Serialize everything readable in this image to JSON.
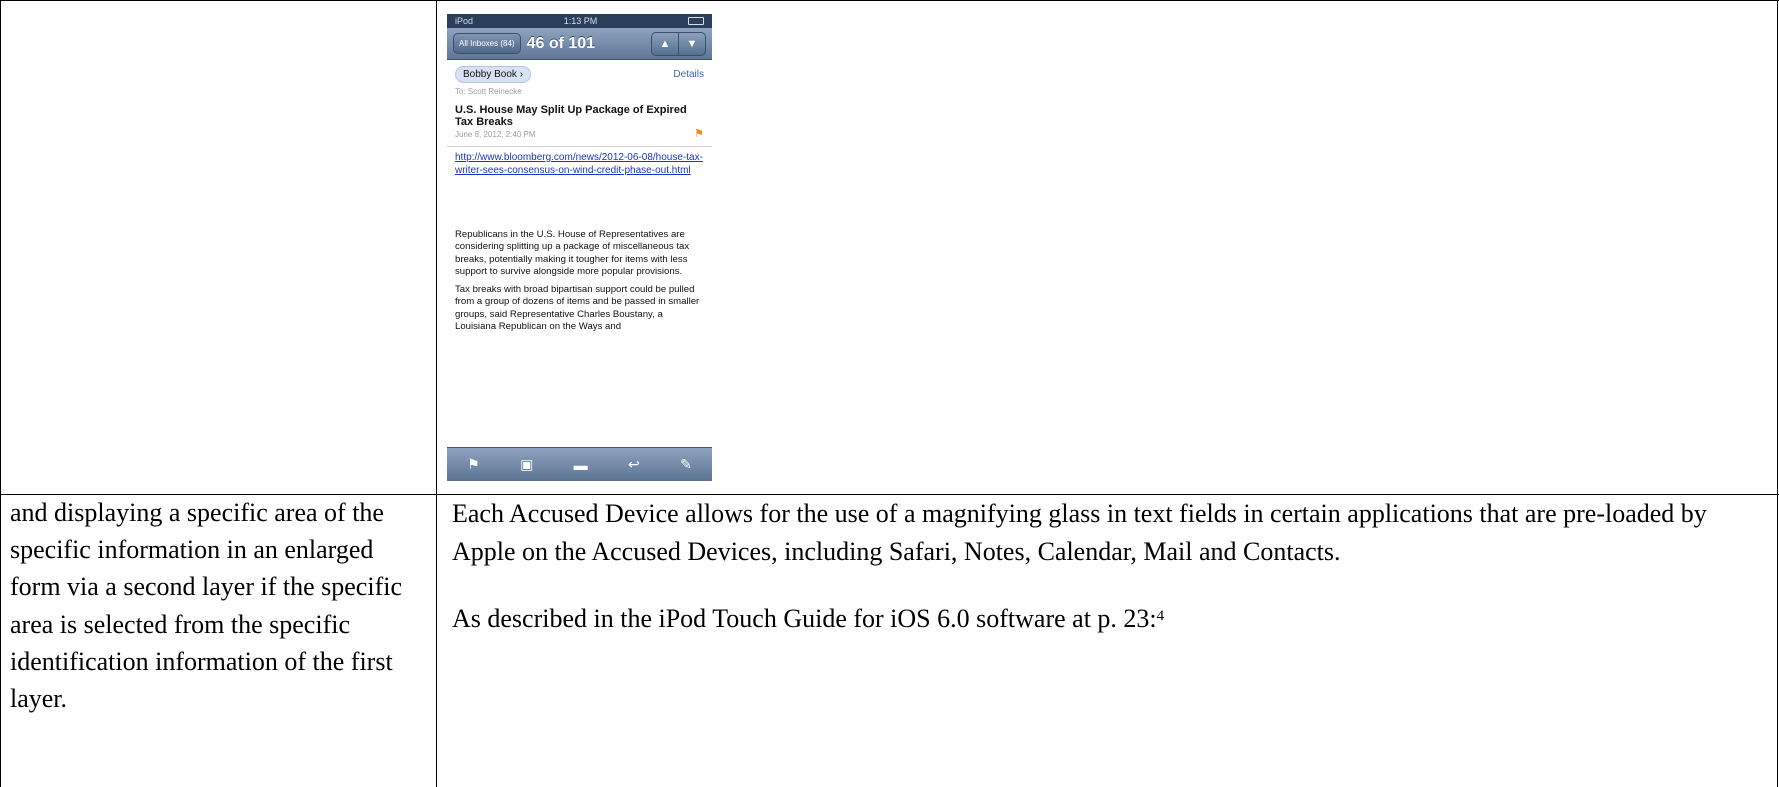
{
  "phone": {
    "status": {
      "carrier": "iPod",
      "time": "1:13 PM"
    },
    "nav": {
      "back_label": "All Inboxes (84)",
      "count": "46 of 101",
      "up_icon": "triangle-up-icon",
      "down_icon": "triangle-down-icon"
    },
    "mail": {
      "sender": "Bobby Book",
      "details": "Details",
      "to": "To: Scott Reinecke",
      "subject": "U.S. House May Split Up Package of Expired Tax Breaks",
      "date": "June 8, 2012, 2:40 PM",
      "link": "http://www.bloomberg.com/news/2012-06-08/house-tax-writer-sees-consensus-on-wind-credit-phase-out.html",
      "paragraph1": "Republicans in the U.S. House of Representatives are considering splitting up a package of miscellaneous tax breaks, potentially making it tougher for items with less support to survive alongside more popular provisions.",
      "paragraph2": "Tax breaks with broad bipartisan support could be pulled from a group of dozens of items and be passed in smaller groups, said Representative Charles Boustany, a Louisiana Republican on the Ways and"
    },
    "toolbar": [
      "flag-icon",
      "move-folder-icon",
      "archive-icon",
      "reply-icon",
      "compose-icon"
    ]
  },
  "claim": {
    "text": "and displaying a specific area of the specific information in an enlarged form via a second layer if the specific area is selected from the specific identification information of the first layer."
  },
  "description": {
    "paragraph1": "Each Accused Device allows for the use of a magnifying glass in text fields in certain applications that are pre-loaded by Apple on the Accused Devices, including Safari, Notes, Calendar, Mail and Contacts.",
    "paragraph2": "As described in the iPod Touch Guide for iOS 6.0 software at p. 23:",
    "footnote_ref": "4"
  }
}
